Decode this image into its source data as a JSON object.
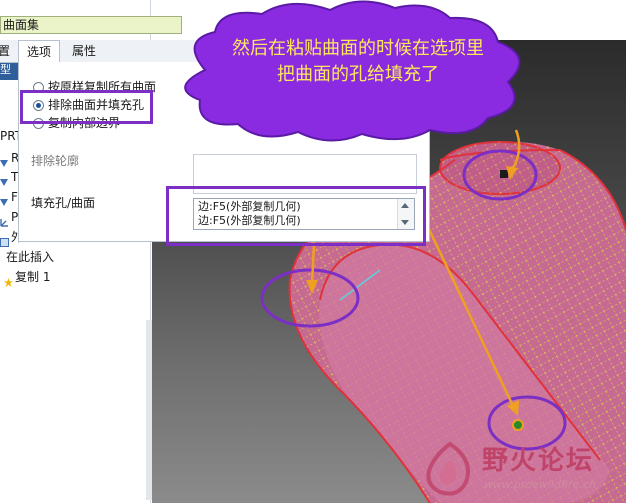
{
  "name_field": {
    "value": "曲面集"
  },
  "tabs": [
    {
      "label": "置"
    },
    {
      "label": "选项"
    },
    {
      "label": "属性"
    }
  ],
  "tree": {
    "sheet_label": "型树",
    "items": [
      {
        "label": "PRT",
        "icon": "part-icon"
      },
      {
        "label": "RI",
        "icon": "datum-plane-icon"
      },
      {
        "label": "TO",
        "icon": "datum-plane-icon"
      },
      {
        "label": "FR",
        "icon": "datum-plane-icon"
      },
      {
        "label": "PR",
        "icon": "coordinate-system-icon"
      },
      {
        "label": "外",
        "icon": "external-copy-geometry-icon"
      },
      {
        "label": "在此插入",
        "icon": ""
      },
      {
        "label": "复制 1",
        "icon": "copy-feature-icon"
      }
    ]
  },
  "options": {
    "radios": [
      {
        "label": "按原样复制所有曲面",
        "checked": false
      },
      {
        "label": "排除曲面并填充孔",
        "checked": true
      },
      {
        "label": "复制内部边界",
        "checked": false
      }
    ],
    "exclude_label": "排除轮廓",
    "fill_label": "填充孔/曲面",
    "fill_items": [
      "边:F5(外部复制几何)",
      "边:F5(外部复制几何)"
    ]
  },
  "callout": {
    "line1": "然后在粘贴曲面的时候在选项里",
    "line2": "把曲面的孔给填充了"
  },
  "watermark": {
    "title": "野火论坛",
    "url": "www.proewildfire.cn"
  },
  "colors": {
    "highlight": "#7c2fc4",
    "callout_fill": "#8a2be2",
    "callout_text": "#ffe95a",
    "arrow": "#f0a020",
    "model_fill": "#c76a92",
    "mesh": "#e5e53a",
    "edge": "#e0323a"
  }
}
